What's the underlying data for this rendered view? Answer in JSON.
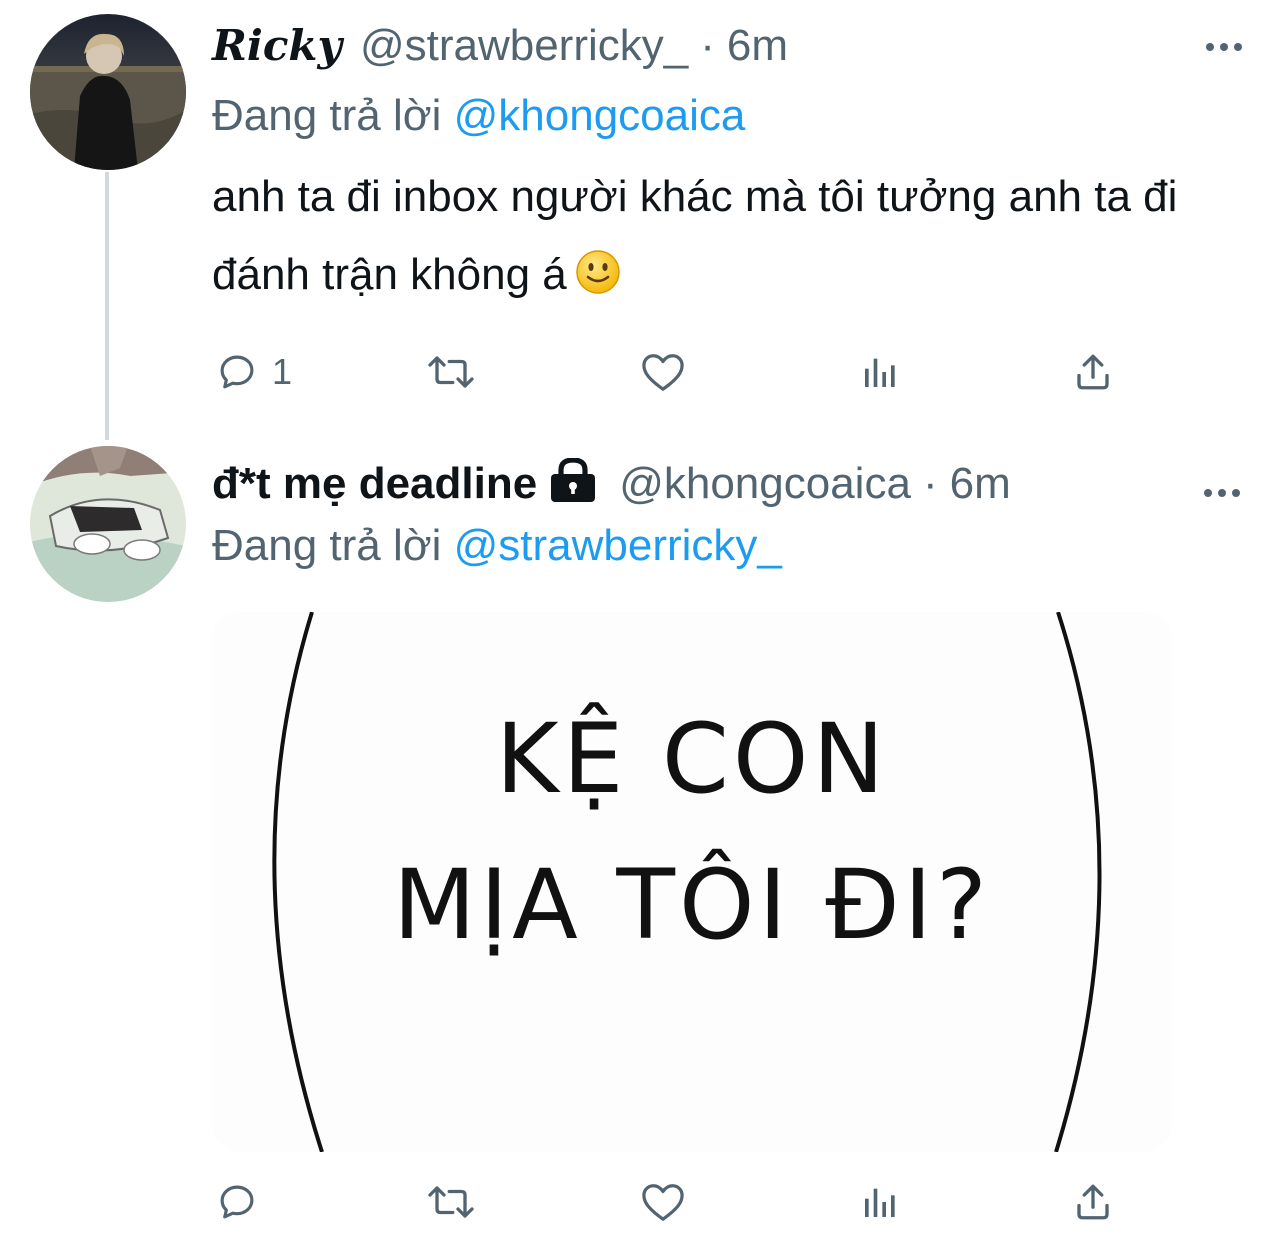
{
  "tweets": [
    {
      "display_name": "Ricky",
      "handle": "@strawberricky_",
      "separator": "·",
      "time": "6m",
      "more_icon": "more-horizontal-icon",
      "reply_prefix": "Đang trả lời",
      "reply_to": "@khongcoaica",
      "text": "anh ta đi inbox người khác mà tôi tưởng anh ta đi đánh trận không á",
      "emoji": "slightly-smiling-face",
      "actions": {
        "reply_count": "1",
        "retweet_count": "",
        "like_count": "",
        "icons": [
          "reply-icon",
          "retweet-icon",
          "like-icon",
          "analytics-icon",
          "share-icon"
        ]
      }
    },
    {
      "display_name": "đ*t mẹ deadline",
      "protected_icon": "lock-icon",
      "handle": "@khongcoaica",
      "separator": "·",
      "time": "6m",
      "more_icon": "more-horizontal-icon",
      "reply_prefix": "Đang trả lời",
      "reply_to": "@strawberricky_",
      "media_text": {
        "line1": "KỆ CON",
        "line2": "MỊA TÔI ĐI?"
      },
      "actions": {
        "reply_count": "",
        "retweet_count": "",
        "like_count": "",
        "icons": [
          "reply-icon",
          "retweet-icon",
          "like-icon",
          "analytics-icon",
          "share-icon"
        ]
      }
    }
  ],
  "colors": {
    "text_primary": "#0f1419",
    "text_secondary": "#536471",
    "mention": "#1d9bf0",
    "thread_line": "#cfd9de"
  }
}
